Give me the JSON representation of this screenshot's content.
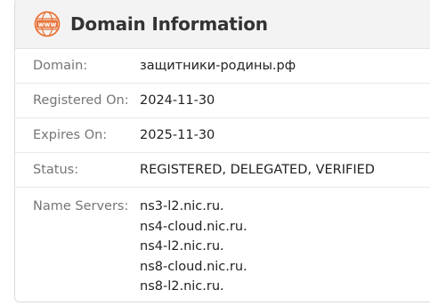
{
  "panel": {
    "title": "Domain Information",
    "icon": "www-icon",
    "icon_text": "www",
    "accent_color": "#e8743b"
  },
  "rows": [
    {
      "label": "Domain:",
      "value": "защитники-родины.рф"
    },
    {
      "label": "Registered On:",
      "value": "2024-11-30"
    },
    {
      "label": "Expires On:",
      "value": "2025-11-30"
    },
    {
      "label": "Status:",
      "value": "REGISTERED, DELEGATED, VERIFIED"
    }
  ],
  "name_servers": {
    "label": "Name Servers:",
    "values": [
      "ns3-l2.nic.ru.",
      "ns4-cloud.nic.ru.",
      "ns4-l2.nic.ru.",
      "ns8-cloud.nic.ru.",
      "ns8-l2.nic.ru."
    ]
  }
}
